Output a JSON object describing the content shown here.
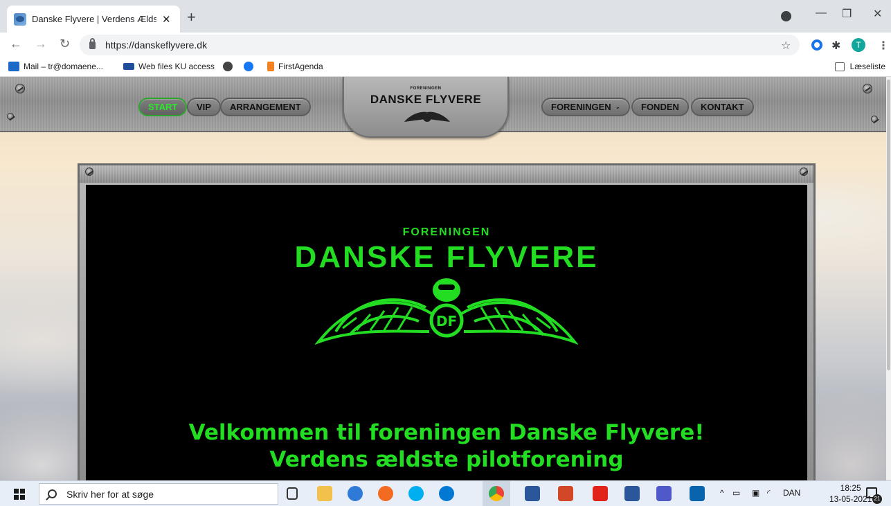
{
  "browser": {
    "tab_title": "Danske Flyvere | Verdens Ældste",
    "tab_close": "✕",
    "new_tab": "+",
    "url": "https://danskeflyvere.dk",
    "avatar_letter": "T",
    "bookmarks": [
      {
        "label": "Mail – tr@domaene...",
        "color": "#1b6ac9"
      },
      {
        "label": "Web files KU access",
        "color": "#1f4e9c"
      },
      {
        "label": "",
        "color": "#444444"
      },
      {
        "label": "",
        "color": "#1877f2"
      },
      {
        "label": "FirstAgenda",
        "color": "#f58220"
      }
    ],
    "reading_list": "Læseliste"
  },
  "site": {
    "nav_left": [
      {
        "label": "START",
        "active": true
      },
      {
        "label": "VIP"
      },
      {
        "label": "ARRANGEMENT"
      }
    ],
    "nav_right": [
      {
        "label": "FORENINGEN",
        "caret": "⌄"
      },
      {
        "label": "FONDEN"
      },
      {
        "label": "KONTAKT"
      }
    ],
    "header_logo_small": "FORENINGEN",
    "header_logo_big": "DANSKE FLYVERE",
    "hero_logo_small": "FORENINGEN",
    "hero_logo_big": "DANSKE FLYVERE",
    "hero_badge": "DF",
    "welcome_line1": "Velkommen til foreningen Danske Flyvere!",
    "welcome_line2": "Verdens ældste pilotforening",
    "accent_color": "#22dd22"
  },
  "taskbar": {
    "search_placeholder": "Skriv her for at søge",
    "language": "DAN",
    "time": "18:25",
    "date": "13-05-2021",
    "notification_count": "21",
    "apps": [
      "task-view",
      "file-explorer",
      "edge",
      "firefox",
      "skype",
      "skype-business",
      "chrome",
      "word",
      "powerpoint",
      "acrobat",
      "word-2",
      "teams",
      "outlook"
    ]
  }
}
